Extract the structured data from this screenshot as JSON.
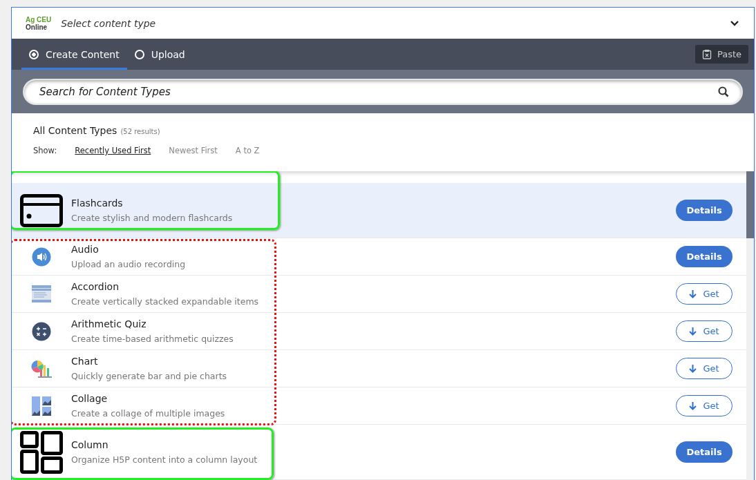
{
  "header": {
    "logo_top": "Ag CEU",
    "logo_bottom": "Online",
    "title": "Select content type"
  },
  "tabs": [
    {
      "label": "Create Content",
      "selected": true
    },
    {
      "label": "Upload",
      "selected": false
    }
  ],
  "paste_button": "Paste",
  "search": {
    "placeholder": "Search for Content Types"
  },
  "list_header": {
    "title": "All Content Types",
    "count": "(52 results)",
    "show_label": "Show:",
    "sort_options": [
      {
        "label": "Recently Used First",
        "selected": true
      },
      {
        "label": "Newest First",
        "selected": false
      },
      {
        "label": "A to Z",
        "selected": false
      }
    ]
  },
  "groups": [
    {
      "kind": "solid",
      "color": "#22ee22",
      "items": [
        {
          "name": "Flashcards",
          "description": "Create stylish and modern flashcards",
          "kind": "installed",
          "action": "Details",
          "selected": true
        }
      ]
    },
    {
      "kind": "dotted",
      "color": "#ee1111",
      "items": [
        {
          "name": "Audio",
          "description": "Upload an audio recording",
          "kind": "installed",
          "action": "Details",
          "selected": false
        },
        {
          "name": "Accordion",
          "description": "Create vertically stacked expandable items",
          "kind": "available",
          "action": "Get",
          "selected": false
        },
        {
          "name": "Arithmetic Quiz",
          "description": "Create time-based arithmetic quizzes",
          "kind": "available",
          "action": "Get",
          "selected": false
        },
        {
          "name": "Chart",
          "description": "Quickly generate bar and pie charts",
          "kind": "available",
          "action": "Get",
          "selected": false
        },
        {
          "name": "Collage",
          "description": "Create a collage of multiple images",
          "kind": "available",
          "action": "Get",
          "selected": false
        }
      ]
    },
    {
      "kind": "solid",
      "color": "#22ee22",
      "items": [
        {
          "name": "Column",
          "description": "Organize H5P content into a column layout",
          "kind": "installed",
          "action": "Details",
          "selected": false
        }
      ]
    }
  ]
}
